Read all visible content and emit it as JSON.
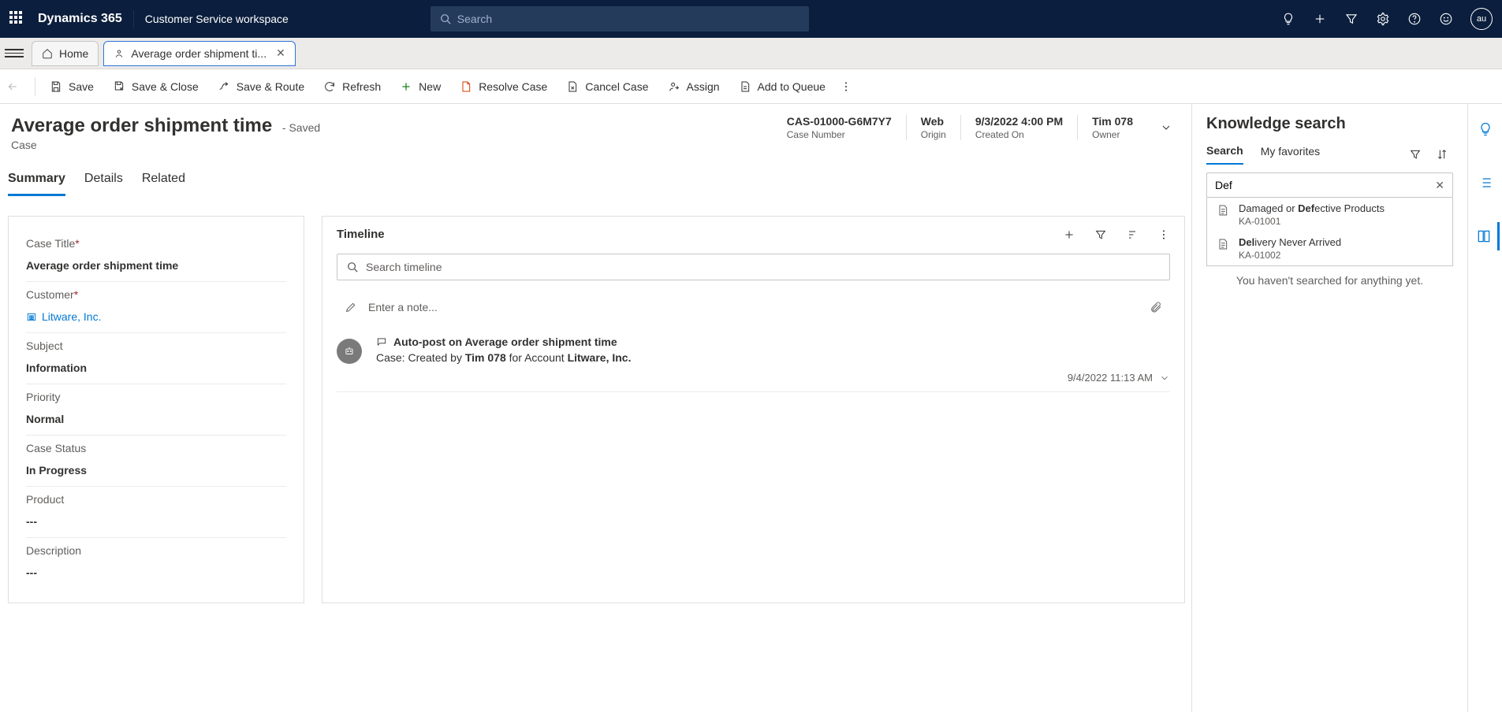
{
  "topbar": {
    "brand": "Dynamics 365",
    "workspace": "Customer Service workspace",
    "search_placeholder": "Search",
    "avatar": "au"
  },
  "tabs": {
    "home": "Home",
    "active": "Average order shipment ti..."
  },
  "commands": {
    "save": "Save",
    "save_close": "Save & Close",
    "save_route": "Save & Route",
    "refresh": "Refresh",
    "new": "New",
    "resolve": "Resolve Case",
    "cancel": "Cancel Case",
    "assign": "Assign",
    "queue": "Add to Queue"
  },
  "record": {
    "title": "Average order shipment time",
    "status": "- Saved",
    "entity": "Case",
    "header_fields": [
      {
        "value": "CAS-01000-G6M7Y7",
        "label": "Case Number"
      },
      {
        "value": "Web",
        "label": "Origin"
      },
      {
        "value": "9/3/2022 4:00 PM",
        "label": "Created On"
      },
      {
        "value": "Tim 078",
        "label": "Owner"
      }
    ]
  },
  "section_tabs": [
    "Summary",
    "Details",
    "Related"
  ],
  "fields": {
    "case_title": {
      "label": "Case Title",
      "required": true,
      "value": "Average order shipment time"
    },
    "customer": {
      "label": "Customer",
      "required": true,
      "value": "Litware, Inc."
    },
    "subject": {
      "label": "Subject",
      "required": false,
      "value": "Information"
    },
    "priority": {
      "label": "Priority",
      "required": false,
      "value": "Normal"
    },
    "case_status": {
      "label": "Case Status",
      "required": false,
      "value": "In Progress"
    },
    "product": {
      "label": "Product",
      "required": false,
      "value": "---"
    },
    "description": {
      "label": "Description",
      "required": false,
      "value": "---"
    }
  },
  "timeline": {
    "title": "Timeline",
    "search_placeholder": "Search timeline",
    "note_placeholder": "Enter a note...",
    "entry": {
      "title": "Auto-post on Average order shipment time",
      "prefix": "Case: Created by ",
      "user": "Tim 078",
      "middle": " for Account ",
      "account": "Litware, Inc.",
      "timestamp": "9/4/2022 11:13 AM"
    }
  },
  "knowledge": {
    "title": "Knowledge search",
    "tabs": [
      "Search",
      "My favorites"
    ],
    "query": "Def",
    "results": [
      {
        "title_pre": "Damaged or ",
        "title_bold": "Def",
        "title_post": "ective Products",
        "id": "KA-01001"
      },
      {
        "title_pre": "",
        "title_bold": "Del",
        "title_post": "ivery Never Arrived",
        "id": "KA-01002"
      }
    ],
    "empty": "You haven't searched for anything yet."
  }
}
